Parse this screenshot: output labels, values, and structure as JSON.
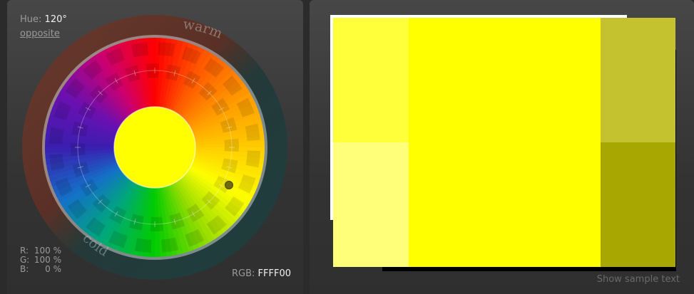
{
  "hue": {
    "label": "Hue:",
    "value": "120°"
  },
  "opposite_label": "opposite",
  "wheel": {
    "warm_label": "warm",
    "cold_label": "cold"
  },
  "rgb": {
    "r_label": "R:",
    "r_value": "100 %",
    "g_label": "G:",
    "g_value": "100 %",
    "b_label": "B:",
    "b_value": "0 %",
    "hex_label": "RGB:",
    "hex_value": "FFFF00"
  },
  "colors": {
    "main": "#FFFF00",
    "lighter": "#FFFF3A",
    "lightest": "#FFFF7A",
    "darker": "#C4C22E",
    "darkest": "#A8A600"
  },
  "sample_text_label": "Show sample text"
}
